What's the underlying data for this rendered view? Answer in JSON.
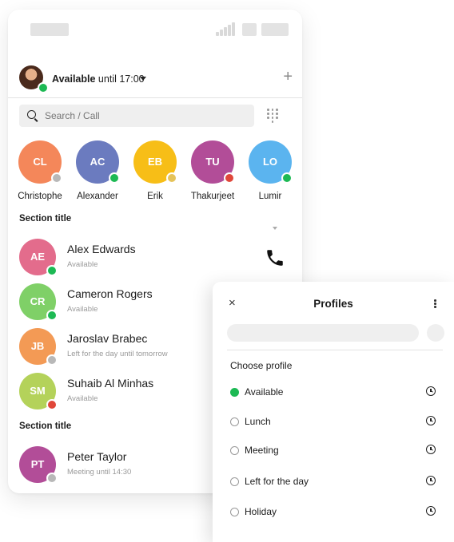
{
  "me": {
    "status_bold": "Available",
    "status_rest": " until 17:00"
  },
  "search": {
    "placeholder": "Search / Call"
  },
  "favorites": [
    {
      "initials": "CL",
      "name": "Christophe",
      "color": "#f4875a",
      "presence": "#b8b8b8"
    },
    {
      "initials": "AC",
      "name": "Alexander",
      "color": "#6b7bbf",
      "presence": "#1db954"
    },
    {
      "initials": "EB",
      "name": "Erik",
      "color": "#f7be17",
      "presence": "#e5c35a"
    },
    {
      "initials": "TU",
      "name": "Thakurjeet",
      "color": "#b24d98",
      "presence": "#e0473a"
    },
    {
      "initials": "LO",
      "name": "Lumir",
      "color": "#5bb4ef",
      "presence": "#1db954"
    }
  ],
  "sections": [
    "Section title",
    "Section title"
  ],
  "contacts": [
    {
      "initials": "AE",
      "name": "Alex Edwards",
      "status": "Available",
      "color": "#e36c8c",
      "presence": "#1db954"
    },
    {
      "initials": "CR",
      "name": "Cameron Rogers",
      "status": "Available",
      "color": "#7fd067",
      "presence": "#1db954"
    },
    {
      "initials": "JB",
      "name": "Jaroslav Brabec",
      "status": "Left for the day until tomorrow",
      "color": "#f39a55",
      "presence": "#b8b8b8"
    },
    {
      "initials": "SM",
      "name": "Suhaib Al Minhas",
      "status": "Available",
      "color": "#b4d25a",
      "presence": "#e0473a"
    },
    {
      "initials": "PT",
      "name": "Peter Taylor",
      "status": "Meeting until 14:30",
      "color": "#b24d98",
      "presence": "#b8b8b8"
    }
  ],
  "profiles": {
    "title": "Profiles",
    "close_glyph": "×",
    "subtitle": "Choose profile",
    "options": [
      {
        "label": "Available",
        "selected": true
      },
      {
        "label": "Lunch",
        "selected": false
      },
      {
        "label": "Meeting",
        "selected": false
      },
      {
        "label": "Left for the day",
        "selected": false
      },
      {
        "label": "Holiday",
        "selected": false
      }
    ]
  },
  "icons": {
    "search": "search-icon",
    "dialpad": "dialpad-icon",
    "add": "plus-icon",
    "call": "phone-icon",
    "menu": "kebab-menu-icon",
    "clock": "clock-icon",
    "close": "close-icon"
  },
  "colors": {
    "available": "#1db954",
    "busy": "#e0473a",
    "away": "#b8b8b8"
  }
}
